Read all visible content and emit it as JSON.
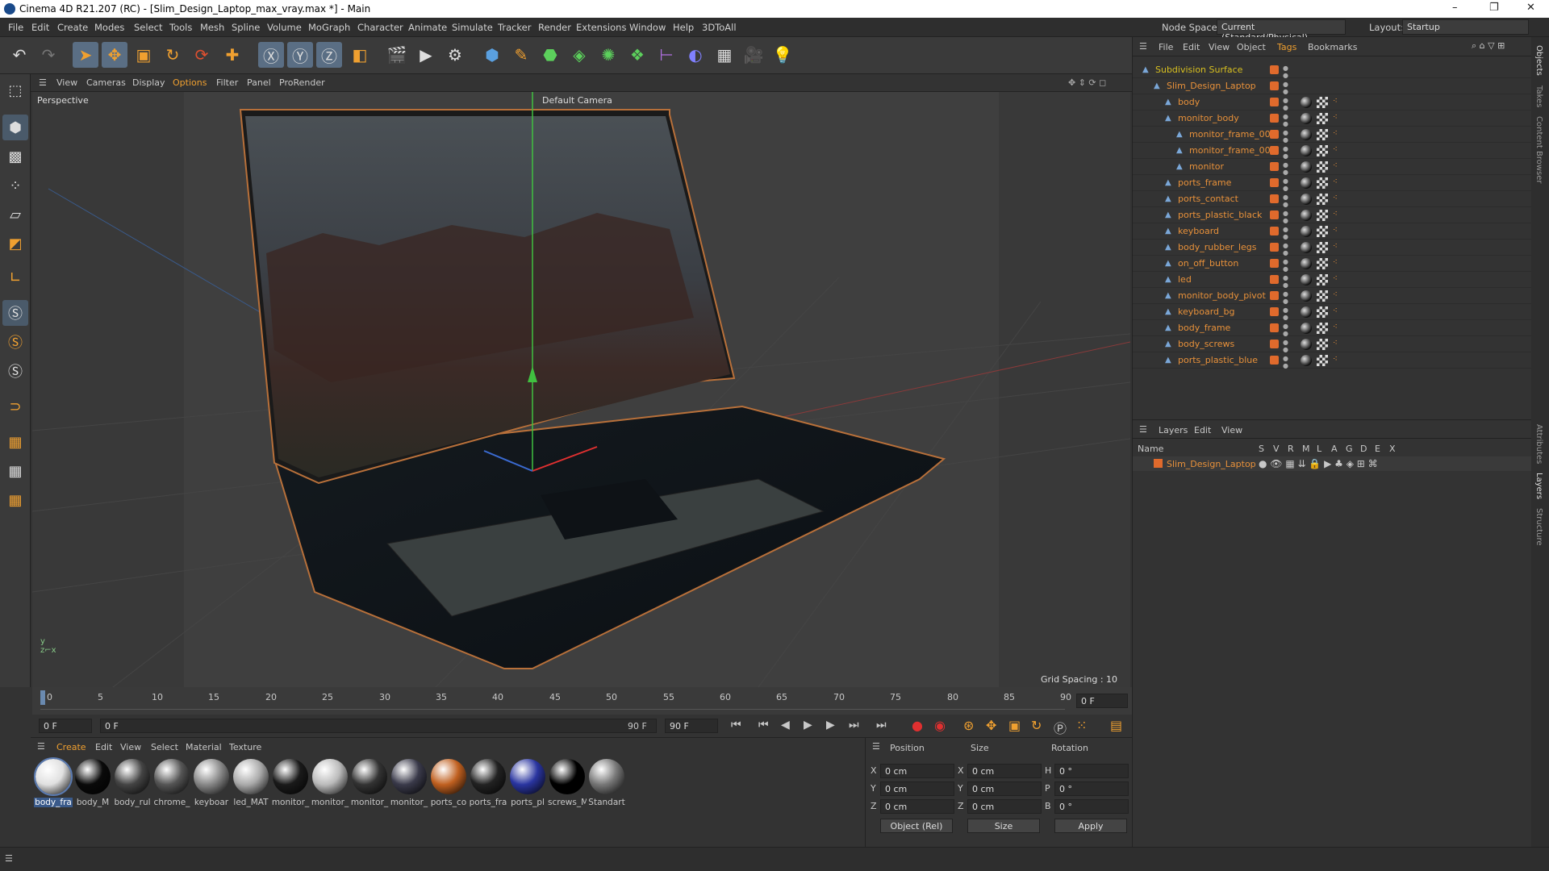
{
  "window": {
    "title": "Cinema 4D R21.207 (RC) - [Slim_Design_Laptop_max_vray.max *] - Main",
    "min": "–",
    "max": "❐",
    "close": "✕"
  },
  "menu": [
    "File",
    "Edit",
    "Create",
    "Modes",
    "Select",
    "Tools",
    "Mesh",
    "Spline",
    "Volume",
    "MoGraph",
    "Character",
    "Animate",
    "Simulate",
    "Tracker",
    "Render",
    "Extensions",
    "Window",
    "Help",
    "3DToAll"
  ],
  "nodespace": {
    "label": "Node Space:",
    "value": "Current (Standard/Physical)"
  },
  "layout": {
    "label": "Layout:",
    "value": "Startup"
  },
  "viewport_menu": [
    "View",
    "Cameras",
    "Display",
    "Options",
    "Filter",
    "Panel",
    "ProRender"
  ],
  "viewport": {
    "name": "Perspective",
    "camera": "Default Camera",
    "grid": "Grid Spacing : 10 cm"
  },
  "timeline": {
    "ticks": [
      "0",
      "5",
      "10",
      "15",
      "20",
      "25",
      "30",
      "35",
      "40",
      "45",
      "50",
      "55",
      "60",
      "65",
      "70",
      "75",
      "80",
      "85",
      "90"
    ],
    "current": "0 F",
    "end_field": "0 F"
  },
  "transport": {
    "start": "0 F",
    "range_start": "0 F",
    "range_end": "90 F",
    "max": "90 F"
  },
  "objects_menu": [
    "File",
    "Edit",
    "View",
    "Object",
    "Tags",
    "Bookmarks"
  ],
  "objects": [
    {
      "name": "Subdivision Surface",
      "level": 0
    },
    {
      "name": "Slim_Design_Laptop",
      "level": 1
    },
    {
      "name": "body",
      "level": 2
    },
    {
      "name": "monitor_body",
      "level": 2
    },
    {
      "name": "monitor_frame_002",
      "level": 3
    },
    {
      "name": "monitor_frame_001",
      "level": 3
    },
    {
      "name": "monitor",
      "level": 3
    },
    {
      "name": "ports_frame",
      "level": 2
    },
    {
      "name": "ports_contact",
      "level": 2
    },
    {
      "name": "ports_plastic_black",
      "level": 2
    },
    {
      "name": "keyboard",
      "level": 2
    },
    {
      "name": "body_rubber_legs",
      "level": 2
    },
    {
      "name": "on_off_button",
      "level": 2
    },
    {
      "name": "led",
      "level": 2
    },
    {
      "name": "monitor_body_pivot",
      "level": 2
    },
    {
      "name": "keyboard_bg",
      "level": 2
    },
    {
      "name": "body_frame",
      "level": 2
    },
    {
      "name": "body_screws",
      "level": 2
    },
    {
      "name": "ports_plastic_blue",
      "level": 2
    }
  ],
  "layers_menu": [
    "Layers",
    "Edit",
    "View"
  ],
  "layers_header": {
    "name": "Name",
    "cols": [
      "S",
      "V",
      "R",
      "M",
      "L",
      "A",
      "G",
      "D",
      "E",
      "X"
    ]
  },
  "layers": [
    {
      "name": "Slim_Design_Laptop"
    }
  ],
  "material_menu": [
    "Create",
    "Edit",
    "View",
    "Select",
    "Material",
    "Texture"
  ],
  "materials": [
    {
      "name": "body_fra",
      "c": "#e0e0e0"
    },
    {
      "name": "body_M",
      "c": "#0a0a0a"
    },
    {
      "name": "body_rul",
      "c": "#444"
    },
    {
      "name": "chrome_",
      "c": "#555"
    },
    {
      "name": "keyboar",
      "c": "#888"
    },
    {
      "name": "led_MAT",
      "c": "#aaa"
    },
    {
      "name": "monitor_",
      "c": "#1a1a1a"
    },
    {
      "name": "monitor_",
      "c": "#bbb"
    },
    {
      "name": "monitor_",
      "c": "#333"
    },
    {
      "name": "monitor_",
      "c": "#3a3a4a"
    },
    {
      "name": "ports_co",
      "c": "#c06020"
    },
    {
      "name": "ports_fra",
      "c": "#222"
    },
    {
      "name": "ports_pl",
      "c": "#2a35a0"
    },
    {
      "name": "screws_M",
      "c": "#000"
    },
    {
      "name": "Standart",
      "c": "#777"
    }
  ],
  "attributes": {
    "position": "Position",
    "size": "Size",
    "rotation": "Rotation",
    "px": "0 cm",
    "py": "0 cm",
    "pz": "0 cm",
    "sx": "0 cm",
    "sy": "0 cm",
    "sz": "0 cm",
    "rh": "0 °",
    "rp": "0 °",
    "rb": "0 °",
    "mode": "Object (Rel)",
    "size_mode": "Size",
    "apply": "Apply"
  },
  "side_tabs": [
    "Objects",
    "Takes",
    "Content Browser",
    "Attributes",
    "Layers",
    "Structure"
  ]
}
